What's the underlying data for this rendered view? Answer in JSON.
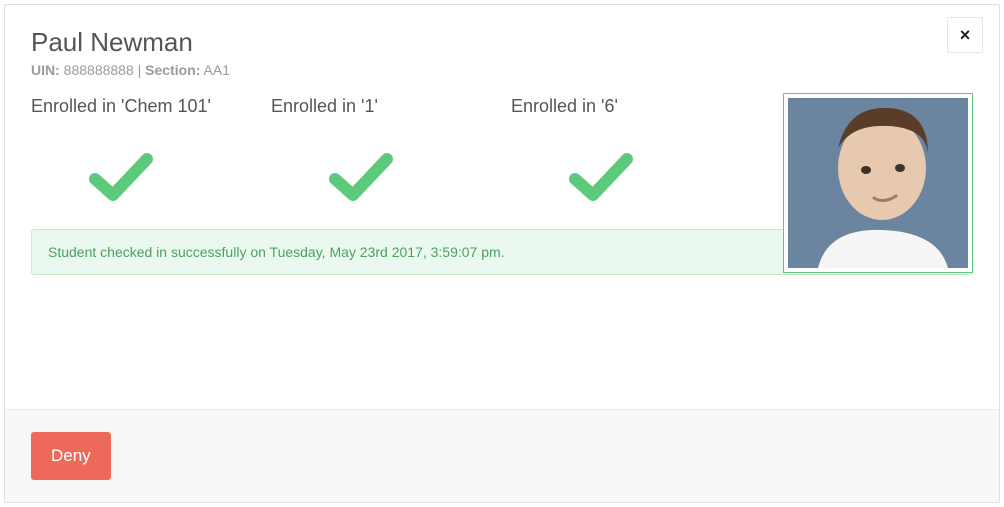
{
  "student": {
    "name": "Paul Newman",
    "uin_label": "UIN:",
    "uin": "888888888",
    "section_label": "Section:",
    "section": "AA1"
  },
  "enrollments": [
    {
      "label": "Enrolled in 'Chem 101'",
      "status": "ok"
    },
    {
      "label": "Enrolled in '1'",
      "status": "ok"
    },
    {
      "label": "Enrolled in '6'",
      "status": "ok"
    }
  ],
  "alert": {
    "message": "Student checked in successfully on Tuesday, May 23rd 2017, 3:59:07 pm."
  },
  "buttons": {
    "deny": "Deny"
  },
  "icons": {
    "close": "×"
  },
  "colors": {
    "success": "#5cca7a",
    "danger": "#ed6a5a",
    "alert_border": "#c7e8cf",
    "alert_bg": "#eaf8ef",
    "alert_text": "#4aa261"
  }
}
